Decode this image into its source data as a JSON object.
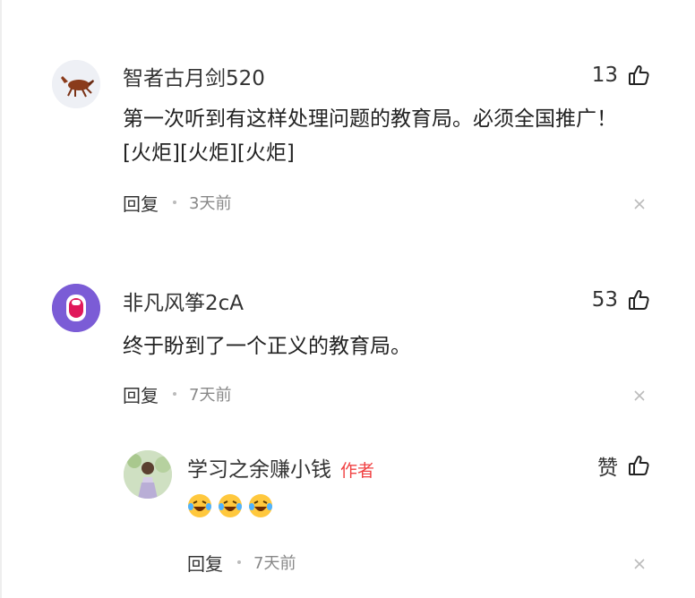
{
  "comments": [
    {
      "username": "智者古月剑520",
      "likes": "13",
      "text": "第一次听到有这样处理问题的教育局。必须全国推广！[火炬][火炬][火炬]",
      "reply_label": "回复",
      "time": "3天前"
    },
    {
      "username": "非凡风筝2cA",
      "likes": "53",
      "text": "终于盼到了一个正义的教育局。",
      "reply_label": "回复",
      "time": "7天前"
    }
  ],
  "author_reply": {
    "username": "学习之余赚小钱",
    "badge": "作者",
    "like_label": "赞",
    "emoji": [
      "laughing-crying-emoji",
      "laughing-crying-emoji",
      "laughing-crying-emoji"
    ],
    "reply_label": "回复",
    "time": "7天前"
  },
  "colors": {
    "author_badge": "#f04142",
    "like_icon": "#222222",
    "meta_text": "#888888"
  }
}
